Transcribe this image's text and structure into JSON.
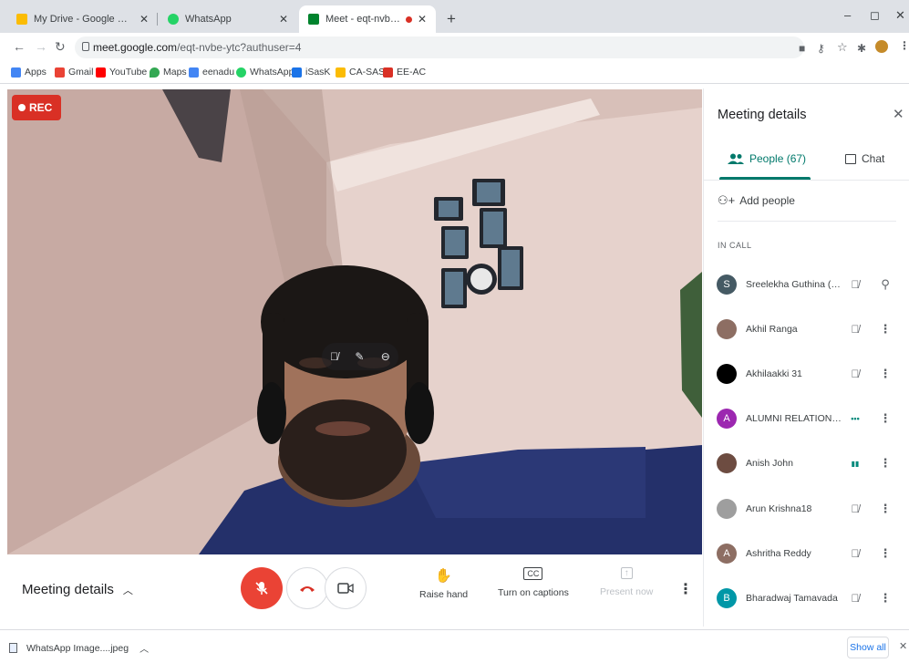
{
  "browser": {
    "tabs": [
      {
        "title": "My Drive - Google Drive",
        "color": "#fbbc04"
      },
      {
        "title": "WhatsApp",
        "color": "#25d366"
      },
      {
        "title": "Meet - eqt-nvbe-ytc",
        "color": "#00832d"
      }
    ],
    "new_tab": "+",
    "url_host": "meet.google.com",
    "url_path": "/eqt-nvbe-ytc?authuser=4",
    "bookmarks": [
      {
        "label": "Apps",
        "color": "#4285f4"
      },
      {
        "label": "Gmail",
        "color": "#ea4335"
      },
      {
        "label": "YouTube",
        "color": "#ff0000"
      },
      {
        "label": "Maps",
        "color": "#34a853"
      },
      {
        "label": "eenadu",
        "color": "#4285f4"
      },
      {
        "label": "WhatsApp",
        "color": "#25d366"
      },
      {
        "label": "iSasK",
        "color": "#1a73e8"
      },
      {
        "label": "CA-SAS",
        "color": "#fbbc04"
      },
      {
        "label": "EE-AC",
        "color": "#d93025"
      }
    ]
  },
  "meet": {
    "rec_badge": "REC",
    "bottom": {
      "meeting_details": "Meeting details",
      "raise_hand": "Raise hand",
      "captions": "Turn on captions",
      "present": "Present now"
    },
    "panel": {
      "title": "Meeting details",
      "people_tab": "People (67)",
      "chat_tab": "Chat",
      "add_people": "Add people",
      "in_call": "IN CALL",
      "participants": [
        {
          "name": "Sreelekha Guthina (You)",
          "initial": "S",
          "avatar_color": "#455a64",
          "status_icon": "mic-off-icon",
          "action_icon": "pin-icon"
        },
        {
          "name": "Akhil Ranga",
          "initial": "",
          "avatar_color": "#8d6e63",
          "status_icon": "mic-off-icon",
          "action_icon": "more-vert-icon"
        },
        {
          "name": "Akhilaakki 31",
          "initial": "",
          "avatar_color": "#000000",
          "status_icon": "mic-off-icon",
          "action_icon": "more-vert-icon"
        },
        {
          "name": "ALUMNI RELATIONS CE...",
          "initial": "A",
          "avatar_color": "#9c27b0",
          "status_icon": "dots-icon",
          "action_icon": "more-vert-icon"
        },
        {
          "name": "Anish John",
          "initial": "",
          "avatar_color": "#6d4c41",
          "status_icon": "speaking-icon",
          "action_icon": "more-vert-icon"
        },
        {
          "name": "Arun Krishna18",
          "initial": "",
          "avatar_color": "#9e9e9e",
          "status_icon": "mic-off-icon",
          "action_icon": "more-vert-icon"
        },
        {
          "name": "Ashritha Reddy",
          "initial": "A",
          "avatar_color": "#8d6e63",
          "status_icon": "mic-off-icon",
          "action_icon": "more-vert-icon"
        },
        {
          "name": "Bharadwaj Tamavada",
          "initial": "B",
          "avatar_color": "#0097a7",
          "status_icon": "mic-off-icon",
          "action_icon": "more-vert-icon"
        }
      ]
    }
  },
  "downloads": {
    "file": "WhatsApp Image....jpeg",
    "show_all": "Show all"
  }
}
